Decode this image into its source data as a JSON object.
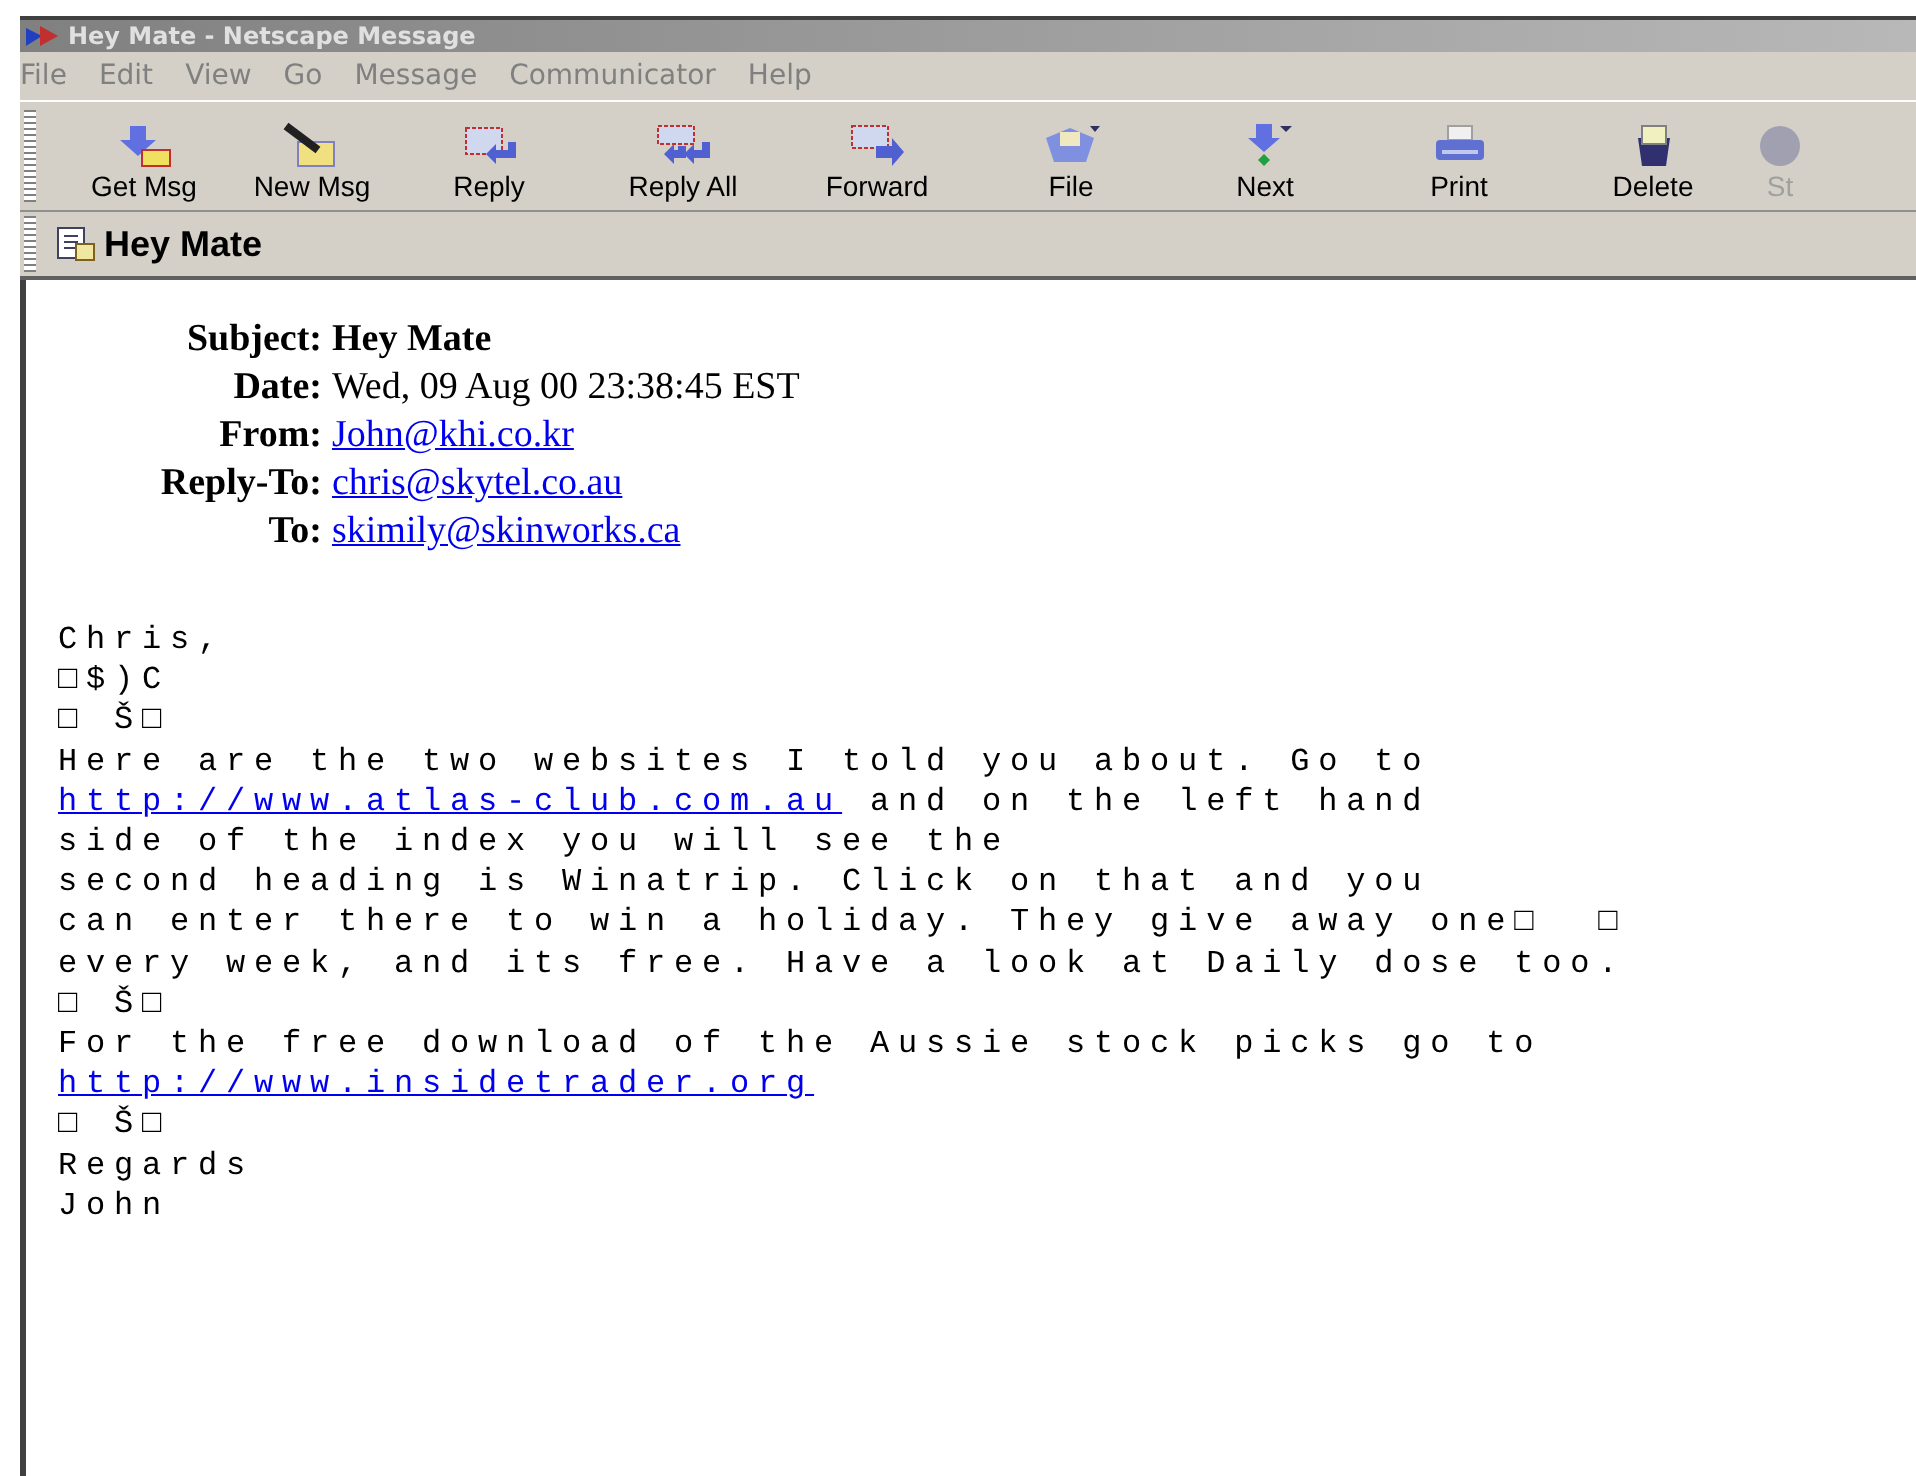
{
  "window": {
    "title": "Hey Mate - Netscape Message"
  },
  "menu": [
    "File",
    "Edit",
    "View",
    "Go",
    "Message",
    "Communicator",
    "Help"
  ],
  "toolbar": [
    {
      "label": "Get Msg",
      "disabled": false
    },
    {
      "label": "New Msg",
      "disabled": false
    },
    {
      "label": "Reply",
      "disabled": false
    },
    {
      "label": "Reply All",
      "disabled": false
    },
    {
      "label": "Forward",
      "disabled": false
    },
    {
      "label": "File",
      "disabled": false
    },
    {
      "label": "Next",
      "disabled": false
    },
    {
      "label": "Print",
      "disabled": false
    },
    {
      "label": "Delete",
      "disabled": false
    },
    {
      "label": "St",
      "disabled": true
    }
  ],
  "header_bar": {
    "title": "Hey Mate"
  },
  "headers": [
    {
      "label": "Subject:",
      "value": "Hey Mate",
      "link": false,
      "bold": true
    },
    {
      "label": "Date:",
      "value": "Wed, 09 Aug 00 23:38:45 EST",
      "link": false,
      "bold": false
    },
    {
      "label": "From:",
      "value": "John@khi.co.kr",
      "link": true,
      "bold": false
    },
    {
      "label": "Reply-To:",
      "value": "chris@skytel.co.au",
      "link": true,
      "bold": false
    },
    {
      "label": "To:",
      "value": "skimily@skinworks.ca",
      "link": true,
      "bold": false
    }
  ],
  "body": [
    [
      {
        "text": "Chris,",
        "link": false
      }
    ],
    [
      {
        "text": "□$)C",
        "link": false
      }
    ],
    [
      {
        "text": "□ Š□",
        "link": false
      }
    ],
    [
      {
        "text": "Here are the two websites I told you about. Go to",
        "link": false
      }
    ],
    [
      {
        "text": "http://www.atlas-club.com.au",
        "link": true
      },
      {
        "text": " and on the left hand",
        "link": false
      }
    ],
    [
      {
        "text": "side of the index you will see the",
        "link": false
      }
    ],
    [
      {
        "text": "second heading is Winatrip. Click on that and you",
        "link": false
      }
    ],
    [
      {
        "text": "can enter there to win a holiday. They give away one□  □",
        "link": false
      }
    ],
    [
      {
        "text": "every week, and its free. Have a look at Daily dose too.",
        "link": false
      }
    ],
    [
      {
        "text": "□ Š□",
        "link": false
      }
    ],
    [
      {
        "text": "For the free download of the Aussie stock picks go to",
        "link": false
      }
    ],
    [
      {
        "text": "http://www.insidetrader.org",
        "link": true
      }
    ],
    [
      {
        "text": "□ Š□",
        "link": false
      }
    ],
    [
      {
        "text": "Regards",
        "link": false
      }
    ],
    [
      {
        "text": "John",
        "link": false
      }
    ]
  ]
}
